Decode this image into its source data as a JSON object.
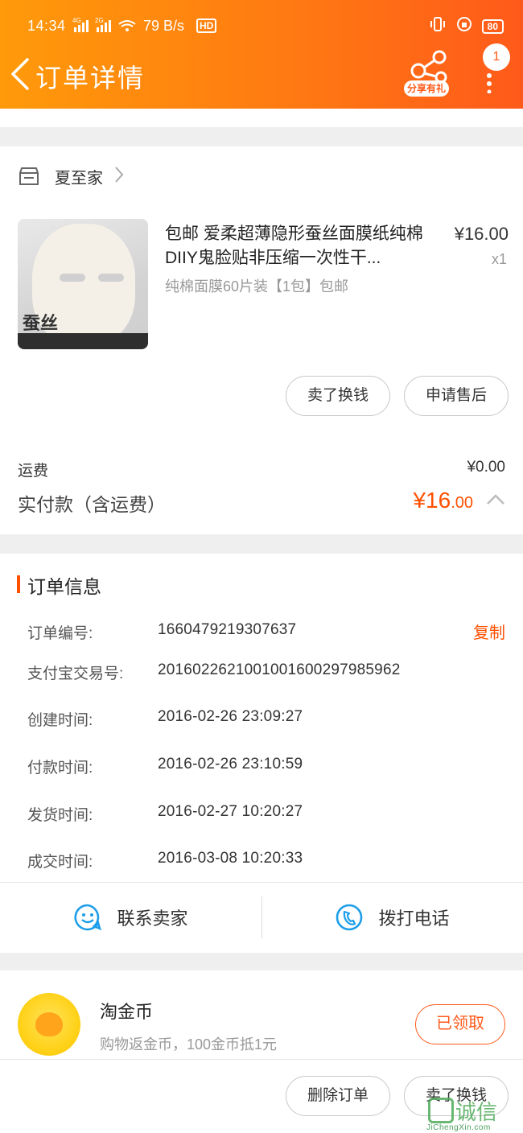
{
  "status_bar": {
    "time": "14:34",
    "network": "4G 2G",
    "speed": "79 B/s",
    "hd": "HD",
    "battery": "80"
  },
  "header": {
    "title": "订单详情",
    "share_label": "分享有礼",
    "notification_count": "1"
  },
  "shop": {
    "name": "夏至家"
  },
  "product": {
    "title": "包邮 爱柔超薄隐形蚕丝面膜纸纯棉DIIY鬼脸贴非压缩一次性干...",
    "price": "¥16.00",
    "quantity": "x1",
    "sku": "纯棉面膜60片装【1包】包邮",
    "image_mark": "蚕丝"
  },
  "item_actions": {
    "sell": "卖了换钱",
    "after_sale": "申请售后"
  },
  "summary": {
    "shipping_label": "运费",
    "shipping_value": "¥0.00",
    "paid_label": "实付款（含运费）",
    "paid_currency": "¥",
    "paid_int": "16",
    "paid_dec": ".00"
  },
  "order_info": {
    "title": "订单信息",
    "copy_label": "复制",
    "rows": [
      {
        "label": "订单编号:",
        "value": "1660479219307637"
      },
      {
        "label": "支付宝交易号:",
        "value": "2016022621001001600297985962"
      },
      {
        "label": "创建时间:",
        "value": "2016-02-26 23:09:27"
      },
      {
        "label": "付款时间:",
        "value": "2016-02-26 23:10:59"
      },
      {
        "label": "发货时间:",
        "value": "2016-02-27 10:20:27"
      },
      {
        "label": "成交时间:",
        "value": "2016-03-08 10:20:33"
      }
    ]
  },
  "contact": {
    "seller": "联系卖家",
    "call": "拨打电话"
  },
  "coins": {
    "title": "淘金币",
    "subtitle": "购物返金币，100金币抵1元",
    "claim": "已领取"
  },
  "bottom_actions": {
    "delete": "删除订单",
    "sell": "卖了换钱"
  },
  "watermark": {
    "text": "诚信",
    "sub": "JiChengXin.com"
  },
  "colors": {
    "accent": "#ff5000",
    "header_start": "#ff9a0a",
    "header_end": "#ff5a1a"
  }
}
